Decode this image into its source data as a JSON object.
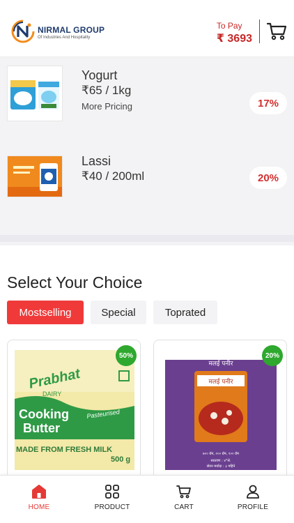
{
  "header": {
    "brand_name": "NIRMAL GROUP",
    "brand_tagline": "Of Industries And Hospitality",
    "to_pay_label": "To Pay",
    "to_pay_amount": "₹ 3693"
  },
  "products": [
    {
      "name": "Yogurt",
      "price": "₹65 / 1kg",
      "more": "More Pricing",
      "discount": "17%",
      "image": "yogurt-packs"
    },
    {
      "name": "Lassi",
      "price": "₹40 / 200ml",
      "discount": "20%",
      "image": "lassi-pack"
    }
  ],
  "section": {
    "title": "Select Your Choice",
    "tabs": [
      "Mostselling",
      "Special",
      "Toprated"
    ],
    "active_tab": "Mostselling"
  },
  "choices": [
    {
      "badge": "50%",
      "image": "cooking-butter",
      "image_text": [
        "Prabhat",
        "DAIRY",
        "Cooking",
        "Butter",
        "Pasteurised",
        "MADE FROM FRESH MILK",
        "500 g"
      ]
    },
    {
      "badge": "20%",
      "image": "malai-paneer",
      "image_text": [
        "मलई पनीर",
        "मलई पनीर",
        "७०० ग्रॅम, २०० ग्रॅम, १०० ग्रॅम",
        "साठवण : ४°से.",
        "सेवन मर्यादा : ३ महिने"
      ]
    }
  ],
  "nav": {
    "items": [
      {
        "label": "HOME",
        "icon": "home-icon",
        "active": true
      },
      {
        "label": "PRODUCT",
        "icon": "grid-icon",
        "active": false
      },
      {
        "label": "CART",
        "icon": "cart-icon",
        "active": false
      },
      {
        "label": "PROFILE",
        "icon": "user-icon",
        "active": false
      }
    ]
  },
  "colors": {
    "accent": "#f03a3a",
    "price_red": "#c62828",
    "badge_green": "#2ea82e",
    "list_bg": "#f3f3f5"
  }
}
